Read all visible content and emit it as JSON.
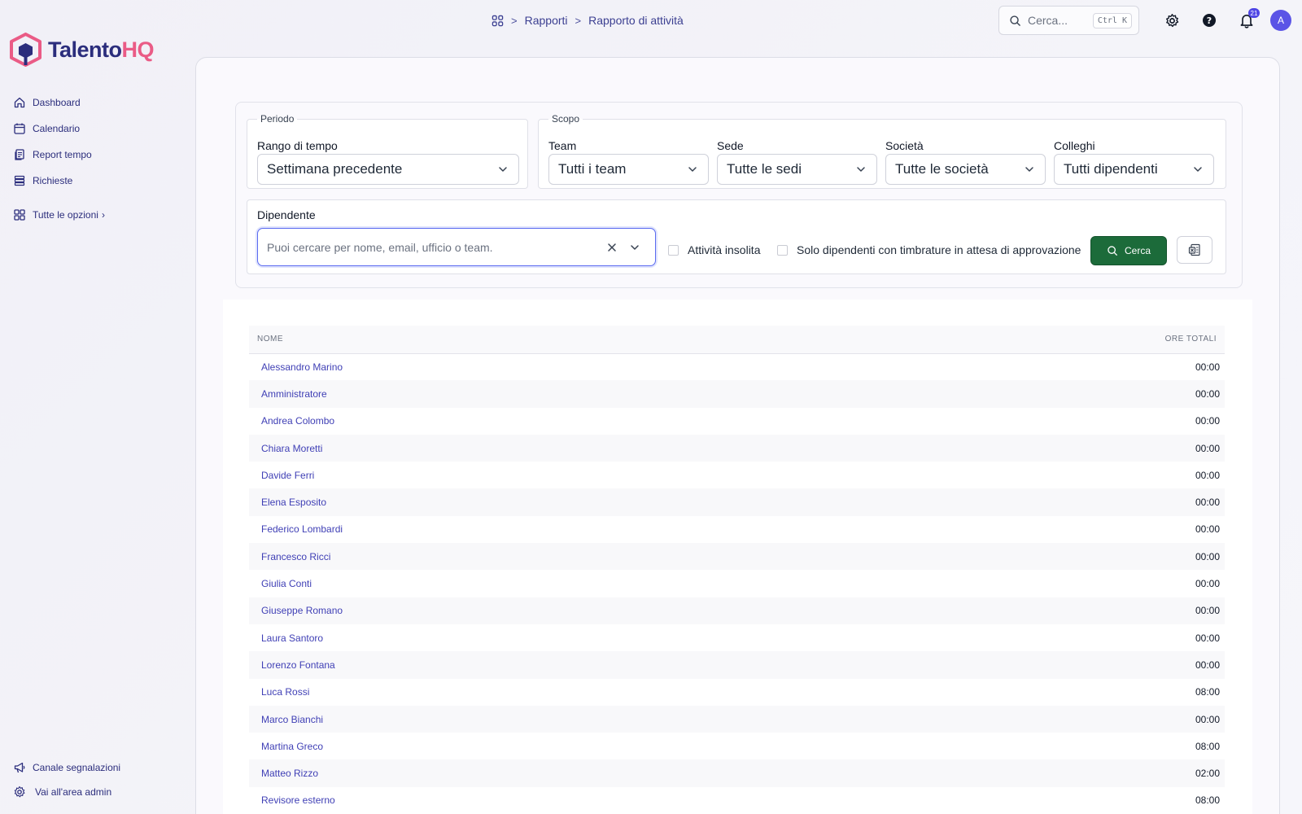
{
  "brand": {
    "name_a": "Talento",
    "name_b": "HQ",
    "accent": "#2b2d7c",
    "accent2": "#ea5b86"
  },
  "sidebar": {
    "items": [
      {
        "label": "Dashboard",
        "icon": "home-icon"
      },
      {
        "label": "Calendario",
        "icon": "calendar-icon"
      },
      {
        "label": "Report tempo",
        "icon": "report-icon"
      },
      {
        "label": "Richieste",
        "icon": "list-icon"
      }
    ],
    "all_options": "Tutte le opzioni",
    "bottom": [
      {
        "label": "Canale segnalazioni",
        "icon": "megaphone-icon"
      },
      {
        "label": "Vai all'area admin",
        "icon": "gear-icon"
      }
    ]
  },
  "breadcrumb": {
    "items": [
      "Rapporti",
      "Rapporto di attività"
    ]
  },
  "topbar": {
    "search_placeholder": "Cerca...",
    "shortcut": "Ctrl K",
    "notifications": "21",
    "avatar": "A"
  },
  "filters": {
    "periodo": {
      "legend": "Periodo",
      "label": "Rango di tempo",
      "value": "Settimana precedente"
    },
    "scopo": {
      "legend": "Scopo",
      "team": {
        "label": "Team",
        "value": "Tutti i team"
      },
      "sede": {
        "label": "Sede",
        "value": "Tutte le sedi"
      },
      "societa": {
        "label": "Società",
        "value": "Tutte le società"
      },
      "colleghi": {
        "label": "Colleghi",
        "value": "Tutti dipendenti"
      }
    },
    "dipendente": {
      "label": "Dipendente",
      "placeholder": "Puoi cercare per nome, email, ufficio o team.",
      "unusual_label": "Attività insolita",
      "pending_label": "Solo dipendenti con timbrature in attesa di approvazione",
      "search_button": "Cerca"
    }
  },
  "table": {
    "headers": {
      "name": "NOME",
      "hours": "ORE TOTALI"
    },
    "rows": [
      {
        "name": "Alessandro Marino",
        "hours": "00:00"
      },
      {
        "name": "Amministratore",
        "hours": "00:00"
      },
      {
        "name": "Andrea Colombo",
        "hours": "00:00"
      },
      {
        "name": "Chiara Moretti",
        "hours": "00:00"
      },
      {
        "name": "Davide Ferri",
        "hours": "00:00"
      },
      {
        "name": "Elena Esposito",
        "hours": "00:00"
      },
      {
        "name": "Federico Lombardi",
        "hours": "00:00"
      },
      {
        "name": "Francesco Ricci",
        "hours": "00:00"
      },
      {
        "name": "Giulia Conti",
        "hours": "00:00"
      },
      {
        "name": "Giuseppe Romano",
        "hours": "00:00"
      },
      {
        "name": "Laura Santoro",
        "hours": "00:00"
      },
      {
        "name": "Lorenzo Fontana",
        "hours": "00:00"
      },
      {
        "name": "Luca Rossi",
        "hours": "08:00"
      },
      {
        "name": "Marco Bianchi",
        "hours": "00:00"
      },
      {
        "name": "Martina Greco",
        "hours": "08:00"
      },
      {
        "name": "Matteo Rizzo",
        "hours": "02:00"
      },
      {
        "name": "Revisore esterno",
        "hours": "08:00"
      }
    ]
  }
}
